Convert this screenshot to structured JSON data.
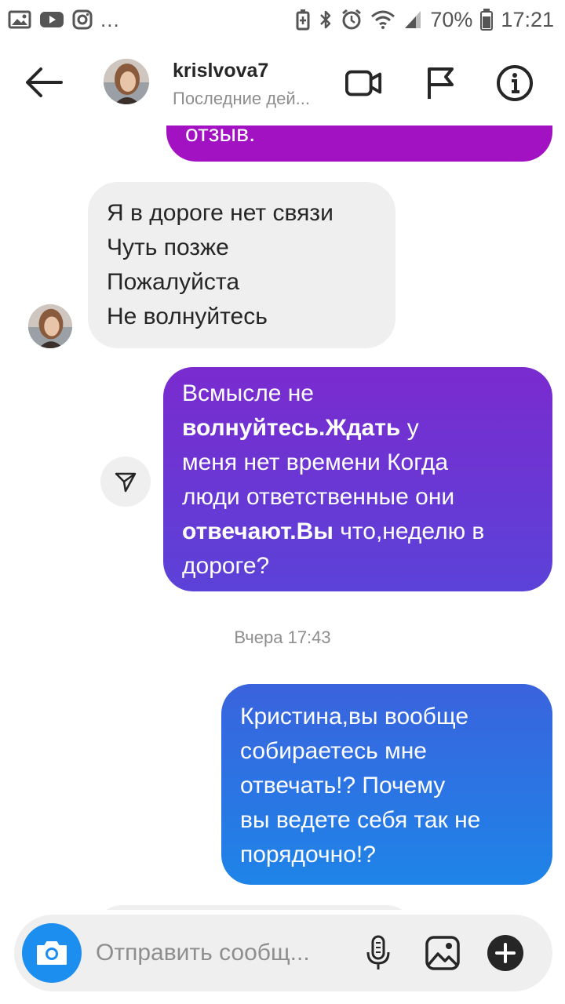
{
  "status_bar": {
    "left_icons": [
      "gallery-icon",
      "youtube-icon",
      "instagram-icon"
    ],
    "dots": "...",
    "battery": "70%",
    "time": "17:21"
  },
  "header": {
    "username": "krislvova7",
    "activity": "Последние дей..."
  },
  "messages": [
    {
      "side": "out",
      "lines": [
        [
          {
            "t": "отзыв."
          }
        ]
      ]
    },
    {
      "side": "in",
      "lines": [
        [
          {
            "t": "Я в дороге нет связи"
          }
        ],
        [
          {
            "t": "Чуть позже"
          }
        ],
        [
          {
            "t": "Пожалуйста"
          }
        ],
        [
          {
            "t": "Не волнуйтесь"
          }
        ]
      ]
    },
    {
      "side": "out",
      "lines": [
        [
          {
            "t": "Всмысле не"
          }
        ],
        [
          {
            "t": "волнуйтесь.Ждать",
            "b": true
          },
          {
            "t": " у"
          }
        ],
        [
          {
            "t": "меня нет времени Когда"
          }
        ],
        [
          {
            "t": "люди ответственные они"
          }
        ],
        [
          {
            "t": "отвечают.Вы",
            "b": true
          },
          {
            "t": " что,неделю в"
          }
        ],
        [
          {
            "t": "дороге?"
          }
        ]
      ]
    },
    {
      "side": "out",
      "lines": [
        [
          {
            "t": "Кристина,вы вообще"
          }
        ],
        [
          {
            "t": "собираетесь мне"
          }
        ],
        [
          {
            "t": "отвечать!? Почему"
          }
        ],
        [
          {
            "t": "вы ведете себя так не"
          }
        ],
        [
          {
            "t": "порядочно!?"
          }
        ]
      ]
    }
  ],
  "timestamp": "Вчера 17:43",
  "composer": {
    "placeholder": "Отправить сообщ..."
  },
  "colors": {
    "gradient_top": "#a312c2",
    "gradient_mid": "#5b42d8",
    "gradient_bottom": "#1e84e8",
    "camera": "#1c8ef0",
    "incoming_bubble": "#efefef"
  }
}
